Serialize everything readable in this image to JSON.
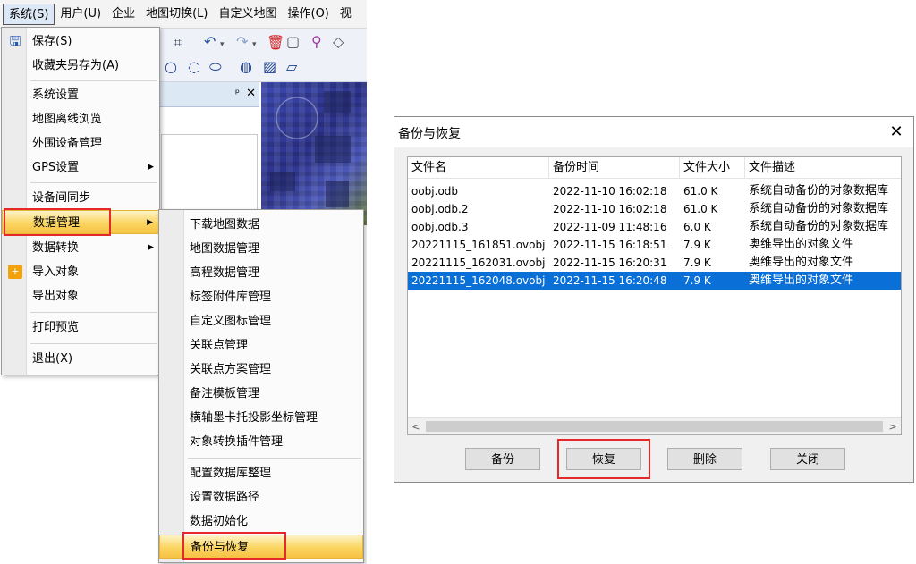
{
  "menubar": {
    "items": [
      "系统(S)",
      "用户(U)",
      "企业",
      "地图切换(L)",
      "自定义地图",
      "操作(O)",
      "视"
    ]
  },
  "panel": {
    "pin": "ᵖ",
    "close": "✕"
  },
  "system_menu": {
    "items": [
      {
        "label": "保存(S)",
        "icon": "save-icon"
      },
      {
        "label": "收藏夹另存为(A)"
      },
      {
        "label": "系统设置"
      },
      {
        "label": "地图离线浏览"
      },
      {
        "label": "外围设备管理"
      },
      {
        "label": "GPS设置",
        "submenu": true
      },
      {
        "label": "设备间同步"
      },
      {
        "label": "数据管理",
        "submenu": true,
        "highlighted": true
      },
      {
        "label": "数据转换",
        "submenu": true
      },
      {
        "label": "导入对象",
        "icon": "import-icon"
      },
      {
        "label": "导出对象"
      },
      {
        "label": "打印预览"
      },
      {
        "label": "退出(X)"
      }
    ]
  },
  "data_menu": {
    "items": [
      "下载地图数据",
      "地图数据管理",
      "高程数据管理",
      "标签附件库管理",
      "自定义图标管理",
      "关联点管理",
      "关联点方案管理",
      "备注模板管理",
      "横轴墨卡托投影坐标管理",
      "对象转换插件管理",
      "配置数据库整理",
      "设置数据路径",
      "数据初始化",
      "备份与恢复"
    ]
  },
  "dialog": {
    "title": "备份与恢复",
    "close": "✕",
    "columns": [
      "文件名",
      "备份时间",
      "文件大小",
      "文件描述"
    ],
    "rows": [
      {
        "name": "oobj.odb",
        "time": "2022-11-10 16:02:18",
        "size": "61.0 K",
        "desc": "系统自动备份的对象数据库"
      },
      {
        "name": "oobj.odb.2",
        "time": "2022-11-10 16:02:18",
        "size": "61.0 K",
        "desc": "系统自动备份的对象数据库"
      },
      {
        "name": "oobj.odb.3",
        "time": "2022-11-09 11:48:16",
        "size": "6.0 K",
        "desc": "系统自动备份的对象数据库"
      },
      {
        "name": "20221115_161851.ovobj",
        "time": "2022-11-15 16:18:51",
        "size": "7.9 K",
        "desc": "奥维导出的对象文件"
      },
      {
        "name": "20221115_162031.ovobj",
        "time": "2022-11-15 16:20:31",
        "size": "7.9 K",
        "desc": "奥维导出的对象文件"
      },
      {
        "name": "20221115_162048.ovobj",
        "time": "2022-11-15 16:20:48",
        "size": "7.9 K",
        "desc": "奥维导出的对象文件",
        "selected": true
      }
    ],
    "scroll_left": "<",
    "scroll_right": ">",
    "buttons": {
      "backup": "备份",
      "restore": "恢复",
      "delete": "删除",
      "close": "关闭"
    }
  },
  "colors": {
    "selection": "#0a6fd6",
    "menu_highlight": "#fbd561",
    "annotation_red": "#e5292b"
  }
}
